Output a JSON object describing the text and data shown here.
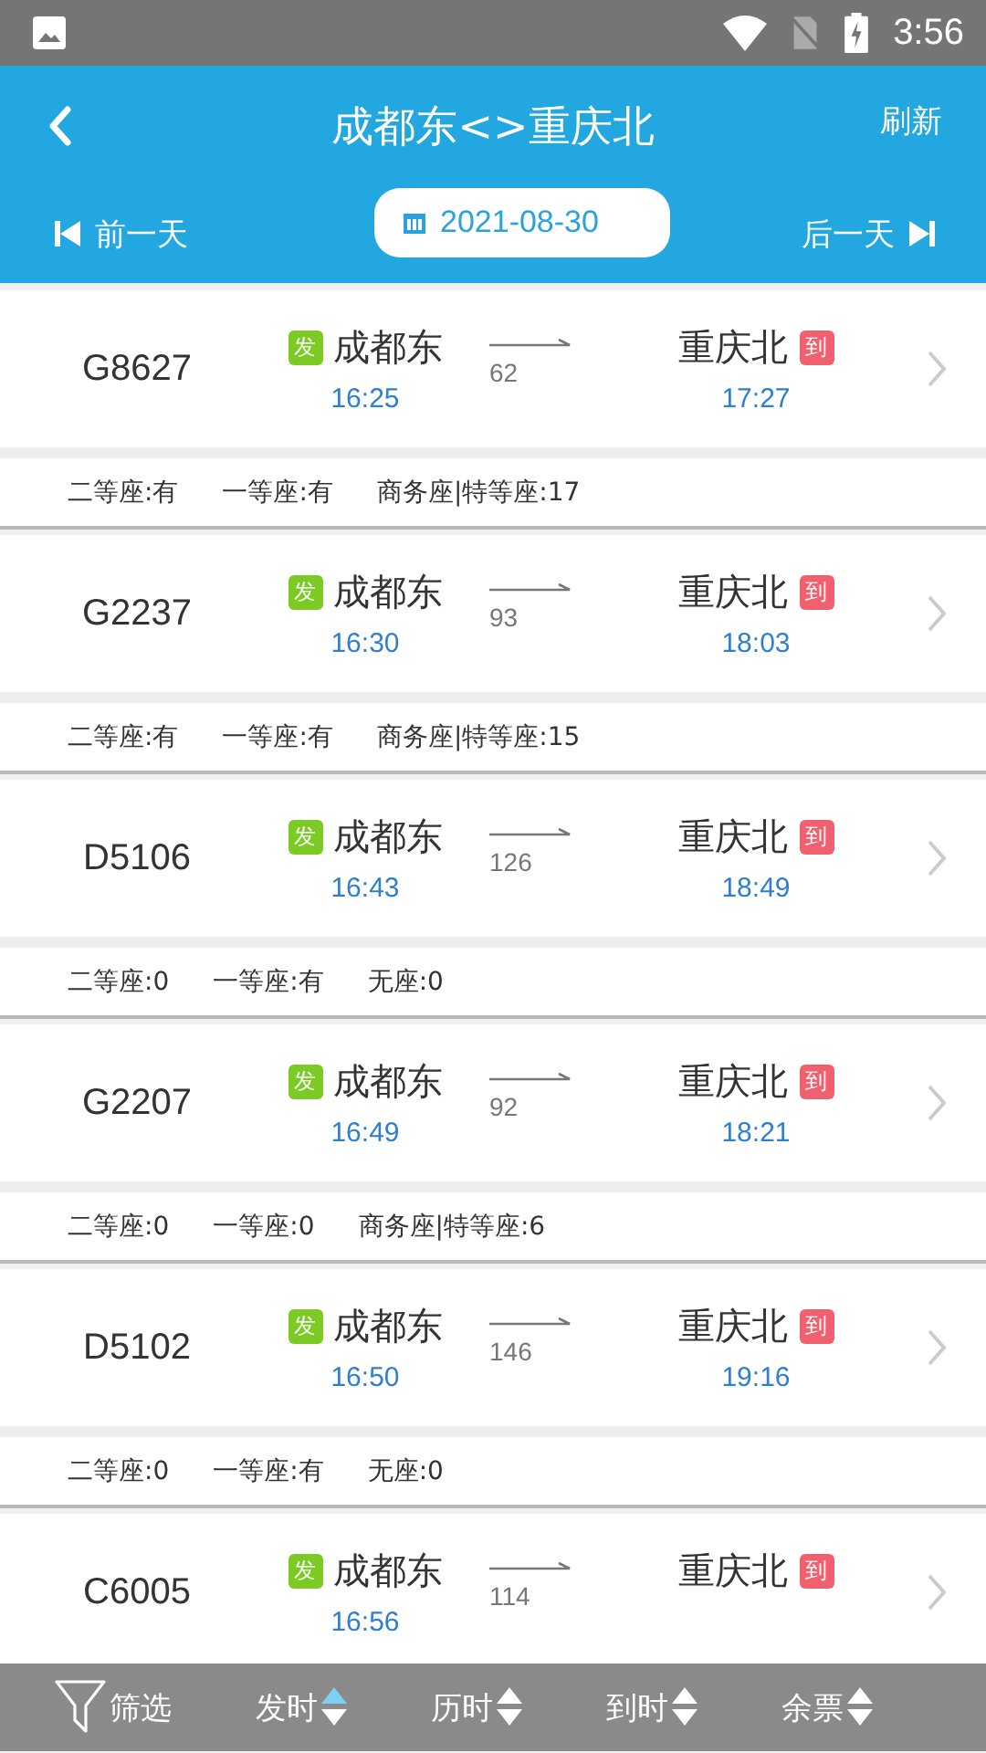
{
  "status_bar": {
    "time": "3:56"
  },
  "header": {
    "title": "成都东<>重庆北",
    "refresh": "刷新",
    "prev_day": "前一天",
    "date": "2021-08-30",
    "next_day": "后一天"
  },
  "trains": [
    {
      "number": "G8627",
      "from_tag": "发",
      "from": "成都东",
      "depart": "16:25",
      "duration": "62",
      "to": "重庆北",
      "to_tag": "到",
      "arrive": "17:27",
      "seats": [
        "二等座:有",
        "一等座:有",
        "商务座|特等座:17"
      ]
    },
    {
      "number": "G2237",
      "from_tag": "发",
      "from": "成都东",
      "depart": "16:30",
      "duration": "93",
      "to": "重庆北",
      "to_tag": "到",
      "arrive": "18:03",
      "seats": [
        "二等座:有",
        "一等座:有",
        "商务座|特等座:15"
      ]
    },
    {
      "number": "D5106",
      "from_tag": "发",
      "from": "成都东",
      "depart": "16:43",
      "duration": "126",
      "to": "重庆北",
      "to_tag": "到",
      "arrive": "18:49",
      "seats": [
        "二等座:0",
        "一等座:有",
        "无座:0"
      ]
    },
    {
      "number": "G2207",
      "from_tag": "发",
      "from": "成都东",
      "depart": "16:49",
      "duration": "92",
      "to": "重庆北",
      "to_tag": "到",
      "arrive": "18:21",
      "seats": [
        "二等座:0",
        "一等座:0",
        "商务座|特等座:6"
      ]
    },
    {
      "number": "D5102",
      "from_tag": "发",
      "from": "成都东",
      "depart": "16:50",
      "duration": "146",
      "to": "重庆北",
      "to_tag": "到",
      "arrive": "19:16",
      "seats": [
        "二等座:0",
        "一等座:有",
        "无座:0"
      ]
    },
    {
      "number": "C6005",
      "from_tag": "发",
      "from": "成都东",
      "depart": "16:56",
      "duration": "114",
      "to": "重庆北",
      "to_tag": "到"
    }
  ],
  "bottom_bar": [
    {
      "kind": "filter",
      "label": "筛选"
    },
    {
      "kind": "sort",
      "label": "发时",
      "selected": true
    },
    {
      "kind": "sort",
      "label": "历时",
      "selected": false
    },
    {
      "kind": "sort",
      "label": "到时",
      "selected": false
    },
    {
      "kind": "sort",
      "label": "余票",
      "selected": false
    }
  ]
}
